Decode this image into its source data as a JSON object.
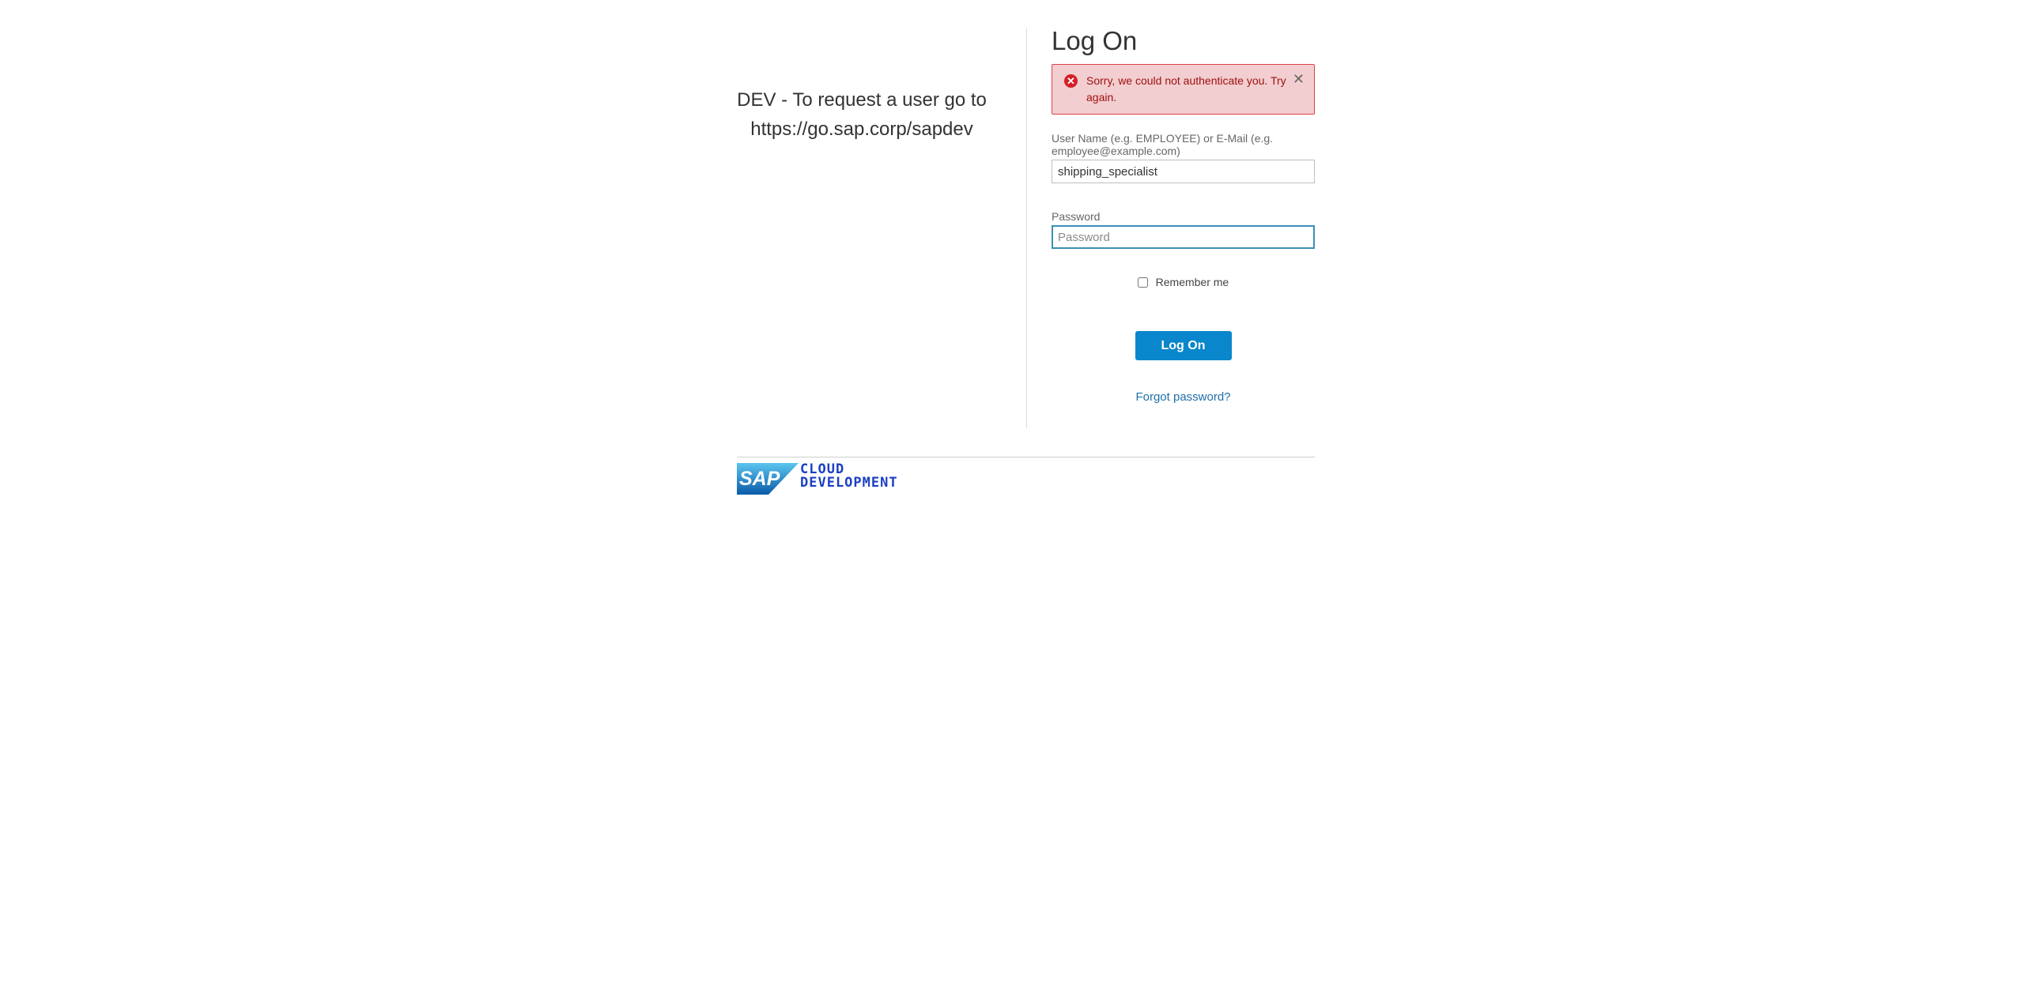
{
  "info": {
    "line1": "DEV - To request a user go to",
    "line2": "https://go.sap.corp/sapdev"
  },
  "logon": {
    "title": "Log On",
    "error_message": "Sorry, we could not authenticate you. Try again.",
    "username_label": "User Name (e.g. EMPLOYEE) or E-Mail (e.g. employee@example.com)",
    "username_value": "shipping_specialist",
    "password_label": "Password",
    "password_placeholder": "Password",
    "remember_label": "Remember me",
    "submit_label": "Log On",
    "forgot_label": "Forgot password?"
  },
  "footer": {
    "logo_text": "SAP",
    "brand_line1": "CLOUD",
    "brand_line2": "DEVELOPMENT"
  },
  "colors": {
    "primary": "#0a86cc",
    "error_bg": "#f2ced0",
    "error_border": "#e0414a",
    "link": "#1f6fa9",
    "brand": "#1a3fc2"
  },
  "icons": {
    "error": "error-circle-icon",
    "close": "close-icon"
  }
}
